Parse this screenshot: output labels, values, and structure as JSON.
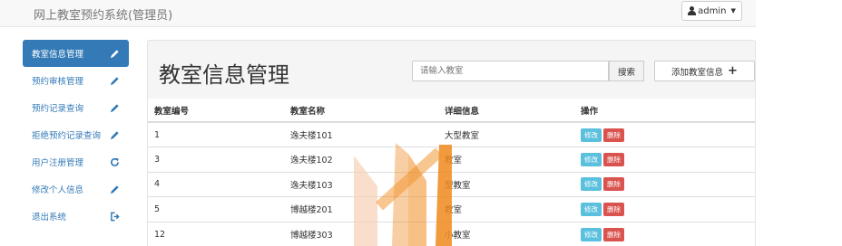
{
  "app": {
    "title": "网上教室预约系统(管理员)"
  },
  "user_menu": {
    "label": "admin"
  },
  "sidebar": {
    "items": [
      {
        "label": "教室信息管理",
        "icon": "pencil-icon"
      },
      {
        "label": "预约审核管理",
        "icon": "pencil-icon"
      },
      {
        "label": "预约记录查询",
        "icon": "pencil-icon"
      },
      {
        "label": "拒绝预约记录查询",
        "icon": "pencil-icon"
      },
      {
        "label": "用户注册管理",
        "icon": "refresh-icon"
      },
      {
        "label": "修改个人信息",
        "icon": "pencil-icon"
      },
      {
        "label": "退出系统",
        "icon": "logout-icon"
      }
    ]
  },
  "main": {
    "title": "教室信息管理",
    "search": {
      "placeholder": "请输入教室",
      "value": "",
      "button": "搜索"
    },
    "add_button": "添加教室信息",
    "table": {
      "headers": [
        "教室编号",
        "教室名称",
        "详细信息",
        "操作"
      ],
      "rows": [
        {
          "id": "1",
          "name": "逸夫楼101",
          "detail": "大型教室"
        },
        {
          "id": "3",
          "name": "逸夫楼102",
          "detail": "教室"
        },
        {
          "id": "4",
          "name": "逸夫楼103",
          "detail": "型教室"
        },
        {
          "id": "5",
          "name": "博越楼201",
          "detail": "教室"
        },
        {
          "id": "12",
          "name": "博越楼303",
          "detail": "小教室"
        }
      ],
      "edit_label": "修改",
      "delete_label": "删除"
    }
  },
  "colors": {
    "primary": "#337ab7",
    "info": "#5bc0de",
    "danger": "#d9534f",
    "watermark": "#f08a1e"
  }
}
